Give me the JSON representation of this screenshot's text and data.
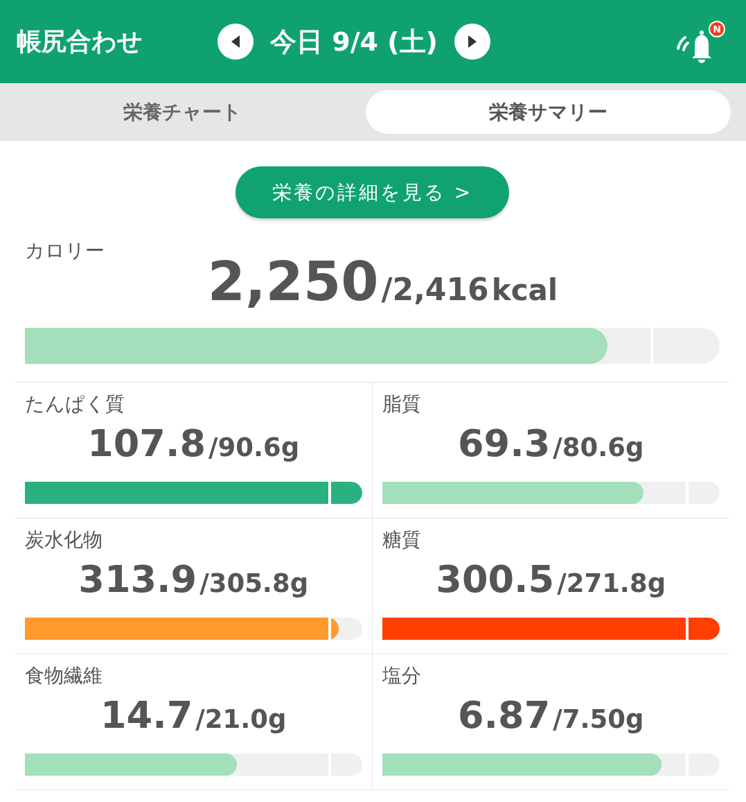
{
  "header": {
    "title": "帳尻合わせ",
    "date": "今日 9/4 (土)",
    "notification_badge": "N"
  },
  "tabs": [
    {
      "label": "栄養チャート",
      "selected": false
    },
    {
      "label": "栄養サマリー",
      "selected": true
    }
  ],
  "detail_button": "栄養の詳細を見る >",
  "calorie": {
    "label": "カロリー",
    "value": "2,250",
    "target": "/2,416",
    "unit": "kcal",
    "level": 0.838,
    "color": "#a2dfba"
  },
  "nutrients": [
    {
      "label": "たんぱく質",
      "value": "107.8",
      "target": "/90.6g",
      "level": 1,
      "color": "#2bb07f"
    },
    {
      "label": "脂質",
      "value": "69.3",
      "target": "/80.6g",
      "level": 0.774,
      "color": "#a2dfba"
    },
    {
      "label": "炭水化物",
      "value": "313.9",
      "target": "/305.8g",
      "level": 0.932,
      "color": "#ff9a2b"
    },
    {
      "label": "糖質",
      "value": "300.5",
      "target": "/271.8g",
      "level": 1,
      "color": "#ff3f00"
    },
    {
      "label": "食物繊維",
      "value": "14.7",
      "target": "/21.0g",
      "level": 0.628,
      "color": "#a2dfba"
    },
    {
      "label": "塩分",
      "value": "6.87",
      "target": "/7.50g",
      "level": 0.827,
      "color": "#a2dfba"
    }
  ]
}
